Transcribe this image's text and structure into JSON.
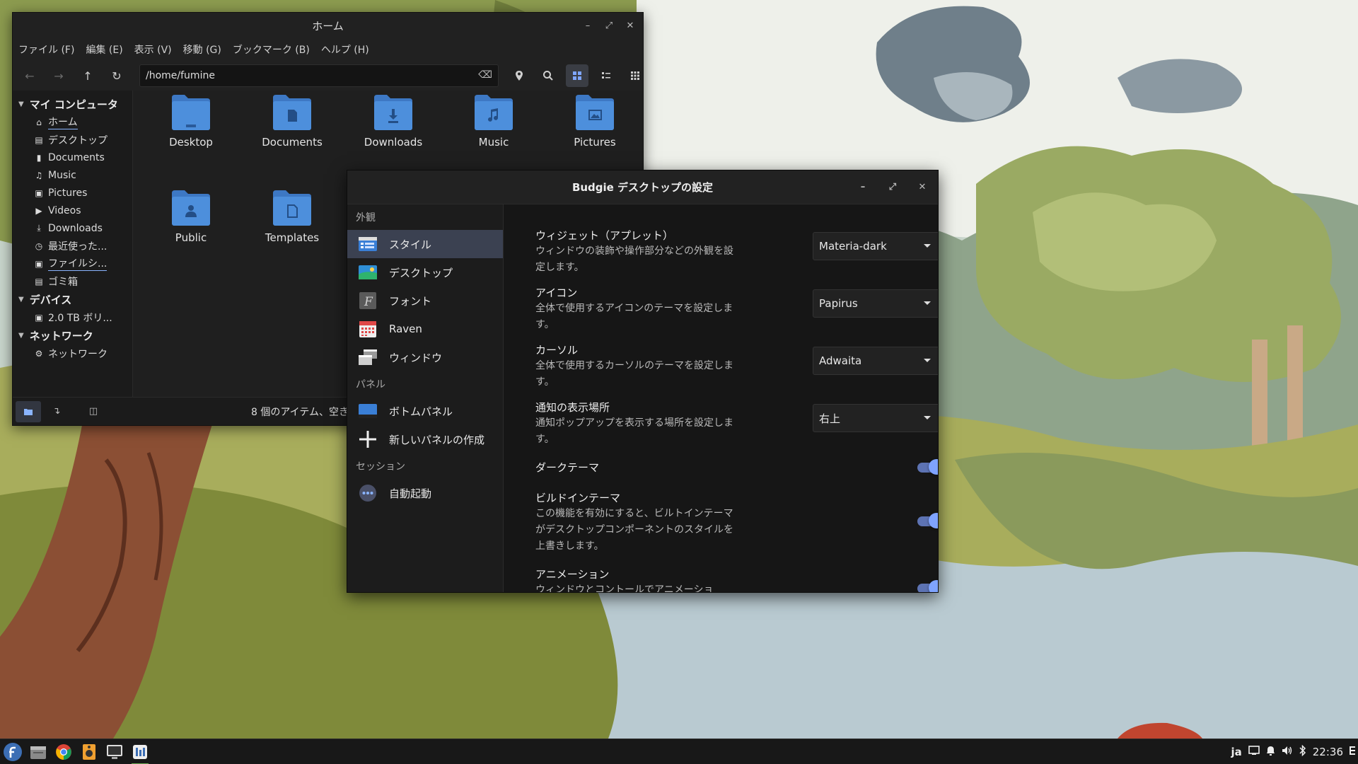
{
  "file_manager": {
    "title": "ホーム",
    "menu": [
      "ファイル (F)",
      "編集 (E)",
      "表示 (V)",
      "移動 (G)",
      "ブックマーク (B)",
      "ヘルプ (H)"
    ],
    "path": "/home/fumine",
    "sidebar": {
      "computer_header": "マイ コンピュータ",
      "computer_items": [
        "ホーム",
        "デスクトップ",
        "Documents",
        "Music",
        "Pictures",
        "Videos",
        "Downloads",
        "最近使った...",
        "ファイルシ...",
        "ゴミ箱"
      ],
      "devices_header": "デバイス",
      "device_items": [
        "2.0 TB ボリ..."
      ],
      "network_header": "ネットワーク",
      "network_items": [
        "ネットワーク"
      ]
    },
    "files": [
      "Desktop",
      "Documents",
      "Downloads",
      "Music",
      "Pictures",
      "Public",
      "Templates"
    ],
    "status": "8 個のアイテム、空き"
  },
  "settings": {
    "title": "Budgie デスクトップの設定",
    "sections": {
      "appearance": "外観",
      "panel": "パネル",
      "session": "セッション"
    },
    "nav": {
      "style": "スタイル",
      "desktop": "デスクトップ",
      "fonts": "フォント",
      "raven": "Raven",
      "windows": "ウィンドウ",
      "bottom_panel": "ボトムパネル",
      "new_panel": "新しいパネルの作成",
      "autostart": "自動起動"
    },
    "rows": {
      "widgets": {
        "title": "ウィジェット（アプレット）",
        "desc": "ウィンドウの装飾や操作部分などの外観を設定します。",
        "value": "Materia-dark"
      },
      "icons": {
        "title": "アイコン",
        "desc": "全体で使用するアイコンのテーマを設定します。",
        "value": "Papirus"
      },
      "cursor": {
        "title": "カーソル",
        "desc": "全体で使用するカーソルのテーマを設定します。",
        "value": "Adwaita"
      },
      "notify": {
        "title": "通知の表示場所",
        "desc": "通知ポップアップを表示する場所を設定します。",
        "value": "右上"
      },
      "dark": {
        "title": "ダークテーマ"
      },
      "builtin": {
        "title": "ビルドインテーマ",
        "desc": "この機能を有効にすると、ビルトインテーマがデスクトップコンポーネントのスタイルを上書きします。"
      },
      "animation": {
        "title": "アニメーション",
        "desc": "ウィンドウとコントールでアニメーショ"
      }
    }
  },
  "taskbar": {
    "lang": "ja",
    "clock": "22:36"
  },
  "colors": {
    "accent": "#7fa4ff",
    "folder": "#4d8fdc",
    "toggle_track": "#5d73b3"
  }
}
